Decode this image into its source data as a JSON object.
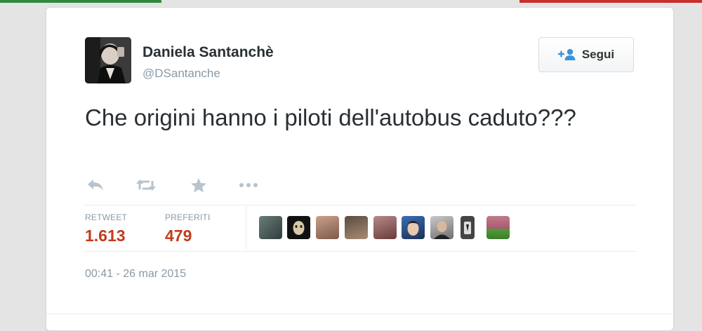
{
  "tweet": {
    "author_name": "Daniela Santanchè",
    "author_handle": "@DSantanche",
    "text": "Che origini hanno i piloti dell'autobus caduto???",
    "timestamp": "00:41 - 26 mar 2015"
  },
  "follow_button": {
    "label": "Segui",
    "icon": "add-user-icon"
  },
  "actions": [
    {
      "name": "reply",
      "icon": "reply-icon"
    },
    {
      "name": "retweet",
      "icon": "retweet-icon"
    },
    {
      "name": "favorite",
      "icon": "star-icon"
    },
    {
      "name": "more",
      "icon": "more-icon"
    }
  ],
  "stats": {
    "retweets": {
      "label": "RETWEET",
      "value": "1.613"
    },
    "favorites": {
      "label": "PREFERITI",
      "value": "479"
    }
  },
  "favoriters_count_shown": 9,
  "colors": {
    "stat_value": "#c33a1b",
    "muted": "#8899a6",
    "text": "#292f33"
  }
}
